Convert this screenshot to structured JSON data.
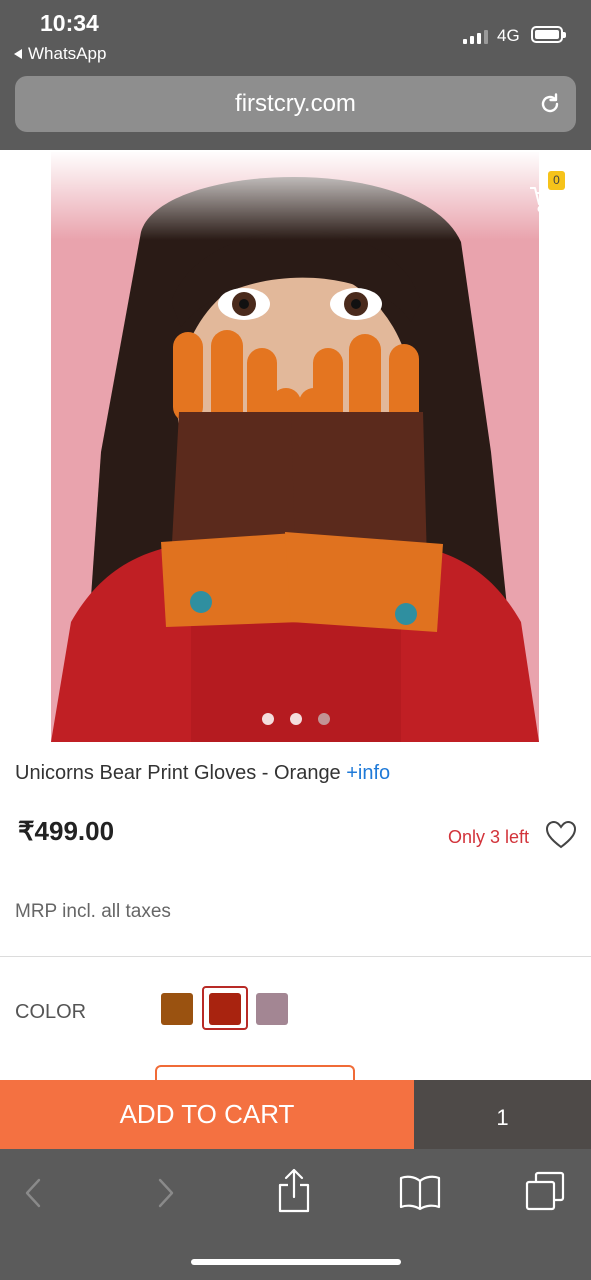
{
  "status_bar": {
    "time": "10:34",
    "back_app": "WhatsApp",
    "network": "4G"
  },
  "browser": {
    "url": "firstcry.com"
  },
  "product": {
    "title": "Unicorns Bear Print Gloves - Orange",
    "info_link": "+info",
    "price": "₹499.00",
    "stock": "Only 3 left",
    "mrp_note": "MRP incl. all taxes",
    "cart_count": "0",
    "image_count": 3,
    "active_image": 1
  },
  "color": {
    "label": "COLOR",
    "swatches": [
      {
        "hex": "#9a5210",
        "selected": false
      },
      {
        "hex": "#a8230f",
        "selected": true
      },
      {
        "hex": "#a38693",
        "selected": false
      }
    ]
  },
  "actions": {
    "add_to_cart": "ADD TO CART",
    "quantity": "1"
  },
  "colors": {
    "accent": "#f47141",
    "price_alert": "#d2333a",
    "link": "#1f7ad8",
    "chrome": "#5b5b5b"
  },
  "toolbar_icons": [
    "back-icon",
    "forward-icon",
    "share-icon",
    "bookmarks-icon",
    "tabs-icon"
  ]
}
